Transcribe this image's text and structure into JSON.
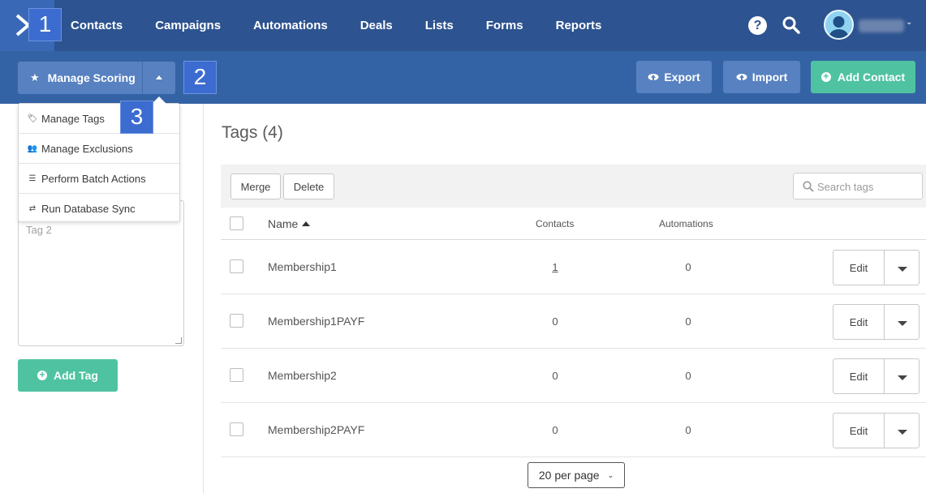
{
  "nav": {
    "items": [
      {
        "label": "Contacts"
      },
      {
        "label": "Campaigns"
      },
      {
        "label": "Automations"
      },
      {
        "label": "Deals"
      },
      {
        "label": "Lists"
      },
      {
        "label": "Forms"
      },
      {
        "label": "Reports"
      }
    ],
    "help_glyph": "?",
    "user_chevron": "⌄"
  },
  "toolbar": {
    "manage_scoring_label": "Manage Scoring",
    "export_label": "Export",
    "import_label": "Import",
    "add_contact_label": "Add Contact"
  },
  "dropdown": {
    "items": [
      {
        "label": "Manage Tags",
        "icon": "tags-icon"
      },
      {
        "label": "Manage Exclusions",
        "icon": "users-icon"
      },
      {
        "label": "Perform Batch Actions",
        "icon": "list-icon"
      },
      {
        "label": "Run Database Sync",
        "icon": "sync-icon"
      }
    ]
  },
  "badges": [
    "1",
    "2",
    "3"
  ],
  "left_panel": {
    "textarea_line": "Tag 2",
    "add_tag_label": "Add Tag"
  },
  "main": {
    "title": "Tags (4)",
    "merge_label": "Merge",
    "delete_label": "Delete",
    "search_placeholder": "Search tags",
    "columns": {
      "name": "Name",
      "contacts": "Contacts",
      "automations": "Automations"
    },
    "rows": [
      {
        "name": "Membership1",
        "contacts": "1",
        "automations": "0",
        "edit": "Edit"
      },
      {
        "name": "Membership1PAYF",
        "contacts": "0",
        "automations": "0",
        "edit": "Edit"
      },
      {
        "name": "Membership2",
        "contacts": "0",
        "automations": "0",
        "edit": "Edit"
      },
      {
        "name": "Membership2PAYF",
        "contacts": "0",
        "automations": "0",
        "edit": "Edit"
      }
    ],
    "per_page_label": "20 per page"
  },
  "colors": {
    "nav_bg": "#2d5390",
    "subbar_bg": "#3463a5",
    "button_blue": "#5781c0",
    "accent_green": "#4fc3a1",
    "badge_blue": "#3c6ccf"
  }
}
